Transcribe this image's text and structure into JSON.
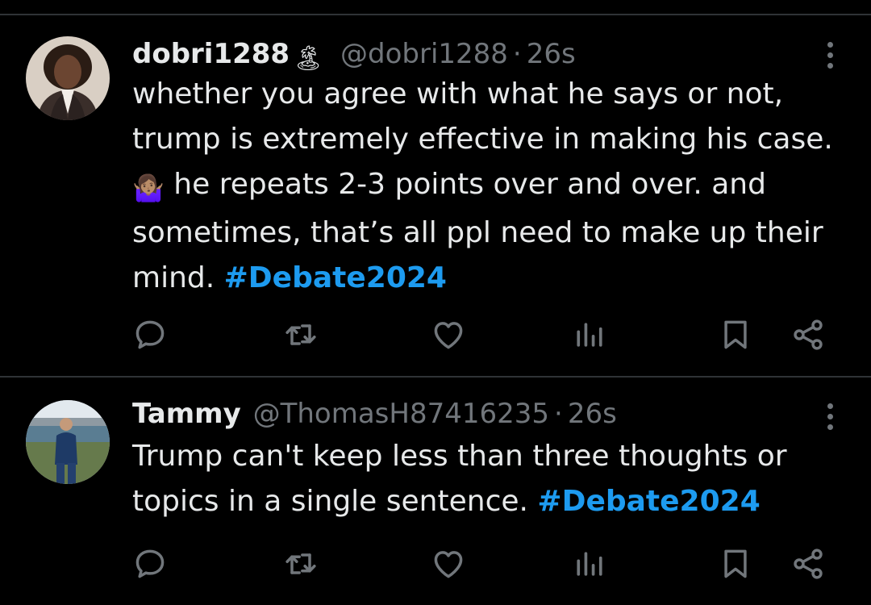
{
  "tweets": [
    {
      "name": "dobri1288",
      "name_emoji": "🏝",
      "handle": "@dobri1288",
      "separator": "·",
      "time": "26s",
      "text_1": "whether you agree with what he says or not, trump is extremely effective in making his case. ",
      "inline_emoji": "🤷🏽‍♀️",
      "text_2": " he repeats 2-3 points over and over. and sometimes, that’s all ppl need to make up their mind. ",
      "hashtag": "#Debate2024"
    },
    {
      "name": "Tammy",
      "handle": "@ThomasH87416235",
      "separator": "·",
      "time": "26s",
      "text_1": "Trump can't keep less than three thoughts or topics in a single sentence. ",
      "hashtag": "#Debate2024"
    }
  ],
  "icons": {
    "reply": "reply-icon",
    "retweet": "retweet-icon",
    "like": "heart-icon",
    "views": "views-icon",
    "bookmark": "bookmark-icon",
    "share": "share-icon",
    "more": "more-vertical-icon"
  },
  "colors": {
    "background": "#000000",
    "text": "#e7e9ea",
    "secondary": "#71767b",
    "hashtag": "#1d9bf0",
    "divider": "#2f3336"
  }
}
